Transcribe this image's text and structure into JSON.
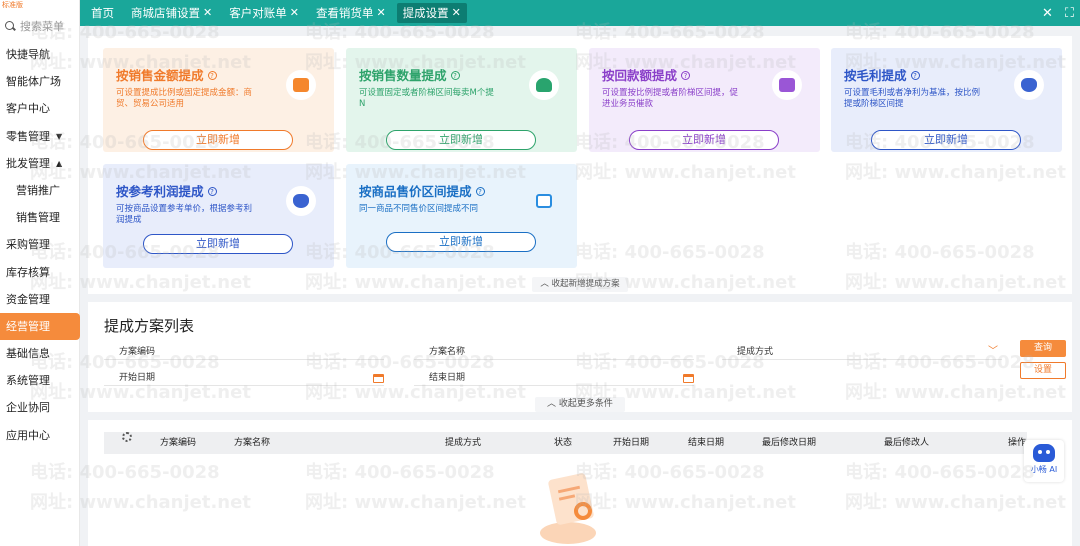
{
  "sidebar": {
    "edition": "标准版",
    "search_placeholder": "搜索菜单",
    "items": [
      {
        "label": "快捷导航"
      },
      {
        "label": "智能体广场"
      },
      {
        "label": "客户中心"
      },
      {
        "label": "零售管理",
        "arrow": "▼"
      },
      {
        "label": "批发管理",
        "arrow": "▲"
      },
      {
        "label": "营销推广"
      },
      {
        "label": "销售管理"
      },
      {
        "label": "采购管理"
      },
      {
        "label": "库存核算"
      },
      {
        "label": "资金管理"
      },
      {
        "label": "经营管理"
      },
      {
        "label": "基础信息"
      },
      {
        "label": "系统管理"
      },
      {
        "label": "企业协同"
      },
      {
        "label": "应用中心"
      }
    ]
  },
  "tabs": [
    {
      "label": "首页"
    },
    {
      "label": "商城店铺设置",
      "close": "✕"
    },
    {
      "label": "客户对账单",
      "close": "✕"
    },
    {
      "label": "查看销货单",
      "close": "✕"
    },
    {
      "label": "提成设置",
      "close": "✕"
    }
  ],
  "window_controls": {
    "close": "✕",
    "fullscreen": "⛶"
  },
  "cards": [
    {
      "title": "按销售金额提成",
      "help": "?",
      "desc": "可设置提成比例或固定提成金额：商贸、贸易公司适用",
      "button": "立即新增",
      "icon": "gift-box-icon"
    },
    {
      "title": "按销售数量提成",
      "help": "?",
      "desc": "可设置固定或者阶梯区间每卖M个提N",
      "button": "立即新增",
      "icon": "upload-box-icon"
    },
    {
      "title": "按回款额提成",
      "help": "?",
      "desc": "可设置按比例提或者阶梯区间提，促进业务员催款",
      "button": "立即新增",
      "icon": "calendar-yen-icon"
    },
    {
      "title": "按毛利提成",
      "help": "?",
      "desc": "可设置毛利或者净利为基准，按比例提或阶梯区间提",
      "button": "立即新增",
      "icon": "money-bag-icon"
    },
    {
      "title": "按参考利润提成",
      "help": "?",
      "desc": "可按商品设置参考单价，根据参考利润提成",
      "button": "立即新增",
      "icon": "chart-coin-icon"
    },
    {
      "title": "按商品售价区间提成",
      "help": "?",
      "desc": "同一商品不同售价区间提成不同",
      "button": "立即新增",
      "icon": "shopping-bag-icon"
    }
  ],
  "collapse_new": "收起新增提成方案",
  "list": {
    "title": "提成方案列表",
    "fields": {
      "code": "方案编码",
      "name": "方案名称",
      "method": "提成方式",
      "start": "开始日期",
      "end": "结束日期"
    },
    "query": "查询",
    "settings": "设置",
    "collapse_more": "收起更多条件"
  },
  "table": {
    "columns": [
      "方案编码",
      "方案名称",
      "提成方式",
      "状态",
      "开始日期",
      "结束日期",
      "最后修改日期",
      "最后修改人",
      "操作"
    ]
  },
  "ai": {
    "label": "小畅 AI"
  },
  "watermark": {
    "phone": "电话: 400-665-0028",
    "site": "网址: www.chanjet.net"
  }
}
